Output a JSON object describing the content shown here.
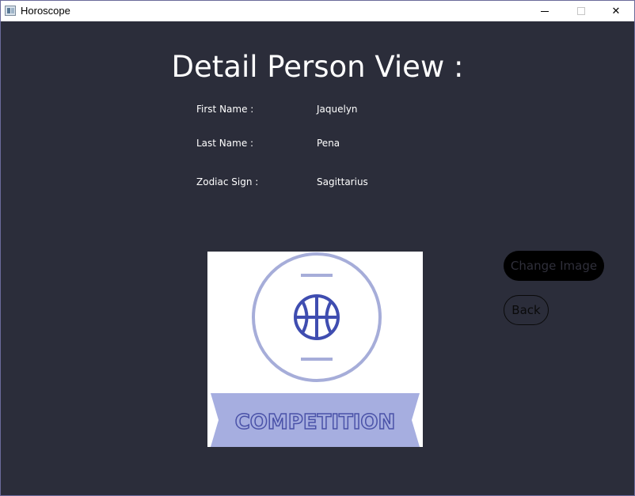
{
  "window": {
    "title": "Horoscope",
    "minimize_icon": "minimize-icon",
    "maximize_icon": "maximize-icon",
    "close_icon": "close-icon",
    "close_glyph": "✕"
  },
  "page": {
    "heading": "Detail Person View :"
  },
  "details": {
    "first_name_label": "First Name :",
    "first_name_value": "Jaquelyn",
    "last_name_label": "Last Name :",
    "last_name_value": "Pena",
    "zodiac_label": "Zodiac Sign :",
    "zodiac_value": "Sagittarius"
  },
  "image": {
    "banner_text": "COMPETITION",
    "icon": "basketball-icon",
    "colors": {
      "ring": "#a6add9",
      "ball": "#3f4db0",
      "banner": "#a6aee0",
      "banner_text": "#4a52a8"
    }
  },
  "buttons": {
    "change_image": "Change Image",
    "back": "Back"
  },
  "colors": {
    "background": "#2b2d3a",
    "titlebar": "#ffffff",
    "text": "#ffffff"
  }
}
